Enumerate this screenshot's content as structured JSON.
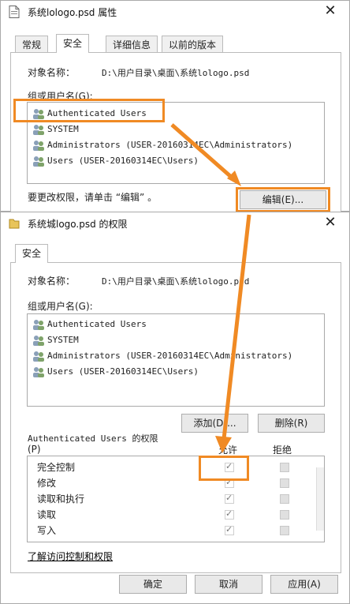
{
  "window1": {
    "title": "系统lologo.psd 属性",
    "close_glyph": "✕",
    "tabs": [
      "常规",
      "安全",
      "详细信息",
      "以前的版本"
    ],
    "object_label": "对象名称：",
    "object_value": "D:\\用户目录\\桌面\\系统lologo.psd",
    "group_label": "组或用户名(G):",
    "users": [
      "Authenticated Users",
      "SYSTEM",
      "Administrators (USER-20160314EC\\Administrators)",
      "Users (USER-20160314EC\\Users)"
    ],
    "change_text": "要更改权限，请单击 “编辑” 。",
    "edit_button": "编辑(E)..."
  },
  "window2": {
    "title": "系统城logo.psd 的权限",
    "close_glyph": "✕",
    "tab": "安全",
    "object_label": "对象名称：",
    "object_value": "D:\\用户目录\\桌面\\系统lologo.psd",
    "group_label": "组或用户名(G):",
    "users": [
      "Authenticated Users",
      "SYSTEM",
      "Administrators (USER-20160314EC\\Administrators)",
      "Users (USER-20160314EC\\Users)"
    ],
    "add_button": "添加(D)...",
    "remove_button": "删除(R)",
    "perm_title_line1": "Authenticated Users 的权限",
    "perm_title_line2": "(P)",
    "allow_header": "允许",
    "deny_header": "拒绝",
    "permissions": [
      {
        "name": "完全控制",
        "allow": true
      },
      {
        "name": "修改",
        "allow": true
      },
      {
        "name": "读取和执行",
        "allow": true
      },
      {
        "name": "读取",
        "allow": true
      },
      {
        "name": "写入",
        "allow": true
      }
    ],
    "learn_link": "了解访问控制和权限",
    "ok_button": "确定",
    "cancel_button": "取消",
    "apply_button": "应用(A)"
  },
  "colors": {
    "highlight": "#f08a24"
  },
  "icons": [
    "document-icon",
    "folder-icon",
    "users-icon",
    "close-icon",
    "checkmark-icon"
  ]
}
